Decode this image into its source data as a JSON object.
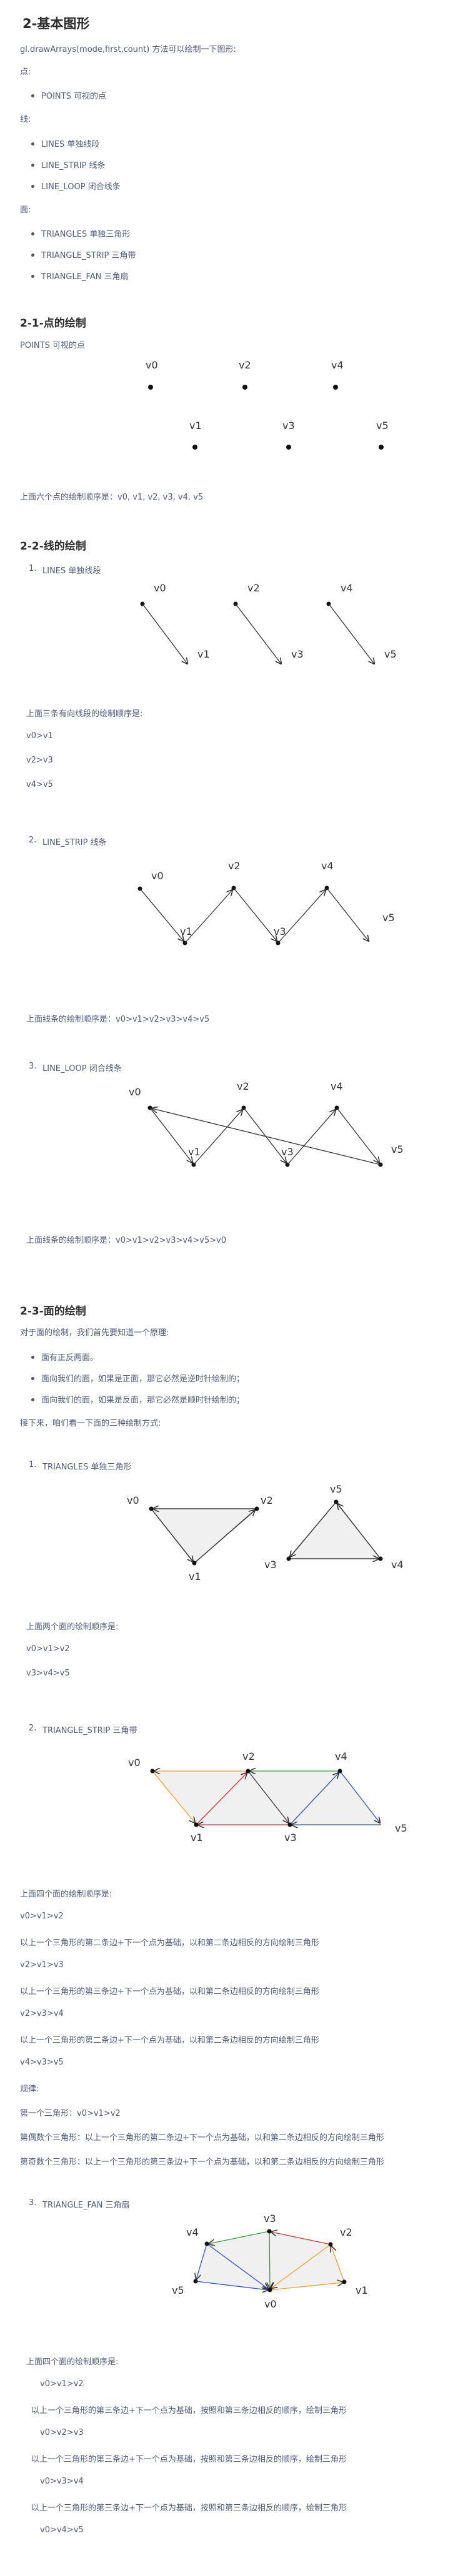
{
  "title": "2-基本图形",
  "intro": {
    "api": "gl.drawArrays(mode,first,count) 方法可以绘制一下图形:",
    "point_label": "点:",
    "points": [
      "POINTS 可视的点"
    ],
    "line_label": "线:",
    "lines": [
      "LINES 单独线段",
      "LINE_STRIP 线条",
      "LINE_LOOP 闭合线条"
    ],
    "face_label": "面:",
    "faces": [
      "TRIANGLES 单独三角形",
      "TRIANGLE_STRIP 三角带",
      "TRIANGLE_FAN 三角扇"
    ]
  },
  "s21": {
    "title": "2-1-点的绘制",
    "sub": "POINTS 可视的点",
    "labels": [
      "v0",
      "v2",
      "v4",
      "v1",
      "v3",
      "v5"
    ],
    "caption": "上面六个点的绘制顺序是：v0, v1, v2, v3, v4, v5"
  },
  "s22": {
    "title": "2-2-线的绘制",
    "lines": {
      "num": "1.",
      "name": "LINES 单独线段",
      "labels": [
        "v0",
        "v1",
        "v2",
        "v3",
        "v4",
        "v5"
      ],
      "caption": "上面三条有向线段的绘制顺序是:",
      "orders": [
        "v0>v1",
        "v2>v3",
        "v4>v5"
      ]
    },
    "strip": {
      "num": "2.",
      "name": "LINE_STRIP 线条",
      "labels": [
        "v0",
        "v1",
        "v2",
        "v3",
        "v4",
        "v5"
      ],
      "caption": "上面线条的绘制顺序是：v0>v1>v2>v3>v4>v5"
    },
    "loop": {
      "num": "3.",
      "name": "LINE_LOOP 闭合线条",
      "labels": [
        "v0",
        "v1",
        "v2",
        "v3",
        "v4",
        "v5"
      ],
      "caption": "上面线条的绘制顺序是：v0>v1>v2>v3>v4>v5>v0"
    }
  },
  "s23": {
    "title": "2-3-面的绘制",
    "intro": "对于面的绘制，我们首先要知道一个原理:",
    "rules": [
      "面有正反两面。",
      "面向我们的面，如果是正面，那它必然是逆时针绘制的；",
      "面向我们的面，如果是反面，那它必然是顺时针绘制的；"
    ],
    "next": "接下来，咱们看一下面的三种绘制方式:",
    "tri": {
      "num": "1.",
      "name": "TRIANGLES 单独三角形",
      "labels": [
        "v0",
        "v2",
        "v1",
        "v5",
        "v3",
        "v4"
      ],
      "caption": "上面两个面的绘制顺序是:",
      "orders": [
        "v0>v1>v2",
        "v3>v4>v5"
      ]
    },
    "strip": {
      "num": "2.",
      "name": "TRIANGLE_STRIP 三角带",
      "labels": [
        "v0",
        "v2",
        "v4",
        "v1",
        "v3",
        "v5"
      ],
      "lines": [
        "上面四个面的绘制顺序是:",
        "v0>v1>v2",
        "以上一个三角形的第二条边+下一个点为基础，以和第二条边相反的方向绘制三角形",
        "v2>v1>v3",
        "以上一个三角形的第三条边+下一个点为基础，以和第二条边相反的方向绘制三角形",
        "v2>v3>v4",
        "以上一个三角形的第二条边+下一个点为基础，以和第二条边相反的方向绘制三角形",
        "v4>v3>v5",
        "规律:",
        "第一个三角形：v0>v1>v2",
        "第偶数个三角形：以上一个三角形的第二条边+下一个点为基础，以和第二条边相反的方向绘制三角形",
        "第奇数个三角形：以上一个三角形的第三条边+下一个点为基础，以和第二条边相反的方向绘制三角形"
      ]
    },
    "fan": {
      "num": "3.",
      "name": "TRIANGLE_FAN 三角扇",
      "labels": [
        "v3",
        "v4",
        "v2",
        "v5",
        "v1",
        "v0"
      ],
      "caption": "上面四个面的绘制顺序是:",
      "lines": [
        "v0>v1>v2",
        "以上一个三角形的第三条边+下一个点为基础，按照和第三条边相反的顺序，绘制三角形",
        "v0>v2>v3",
        "以上一个三角形的第三条边+下一个点为基础，按照和第三条边相反的顺序，绘制三角形",
        "v0>v3>v4",
        "以上一个三角形的第三条边+下一个点为基础，按照和第三条边相反的顺序，绘制三角形",
        "v0>v4>v5"
      ]
    }
  }
}
